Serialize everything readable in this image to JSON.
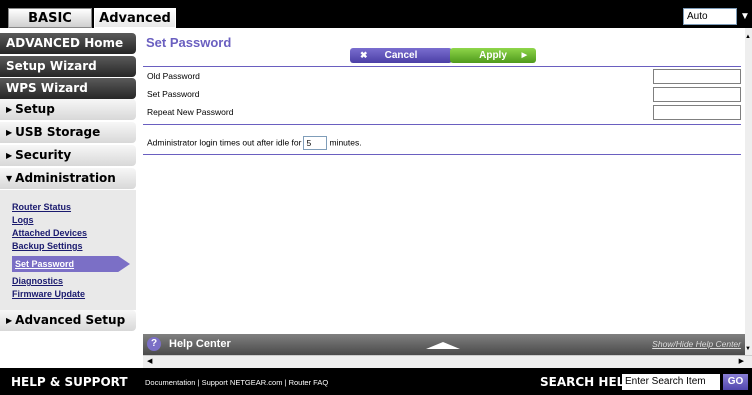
{
  "tabs": {
    "basic": "BASIC",
    "advanced": "Advanced"
  },
  "language": {
    "selected": "Auto"
  },
  "sidebar": {
    "advanced_home": "ADVANCED Home",
    "setup_wizard": "Setup Wizard",
    "wps_wizard": "WPS Wizard",
    "setup": "Setup",
    "usb_storage": "USB Storage",
    "security": "Security",
    "administration": "Administration",
    "admin_items": [
      "Router Status",
      "Logs",
      "Attached Devices",
      "Backup Settings",
      "Set Password",
      "Diagnostics",
      "Firmware Update"
    ],
    "advanced_setup": "Advanced Setup"
  },
  "main": {
    "title": "Set Password",
    "cancel": "Cancel",
    "apply": "Apply",
    "old_password": "Old Password",
    "set_password": "Set Password",
    "repeat_password": "Repeat New Password",
    "timeout_prefix": "Administrator login times out after idle for",
    "timeout_value": "5",
    "timeout_suffix": "minutes."
  },
  "help": {
    "title": "Help Center",
    "toggle": "Show/Hide Help Center"
  },
  "footer": {
    "title": "HELP & SUPPORT",
    "links": [
      "Documentation",
      "Support NETGEAR.com",
      "Router FAQ"
    ],
    "search_label": "SEARCH HELP",
    "search_placeholder": "Enter Search Item",
    "go": "GO"
  },
  "colors": {
    "accent": "#6a5fc0",
    "apply_green": "#4f9a1c",
    "bar_dark": "#000000"
  }
}
